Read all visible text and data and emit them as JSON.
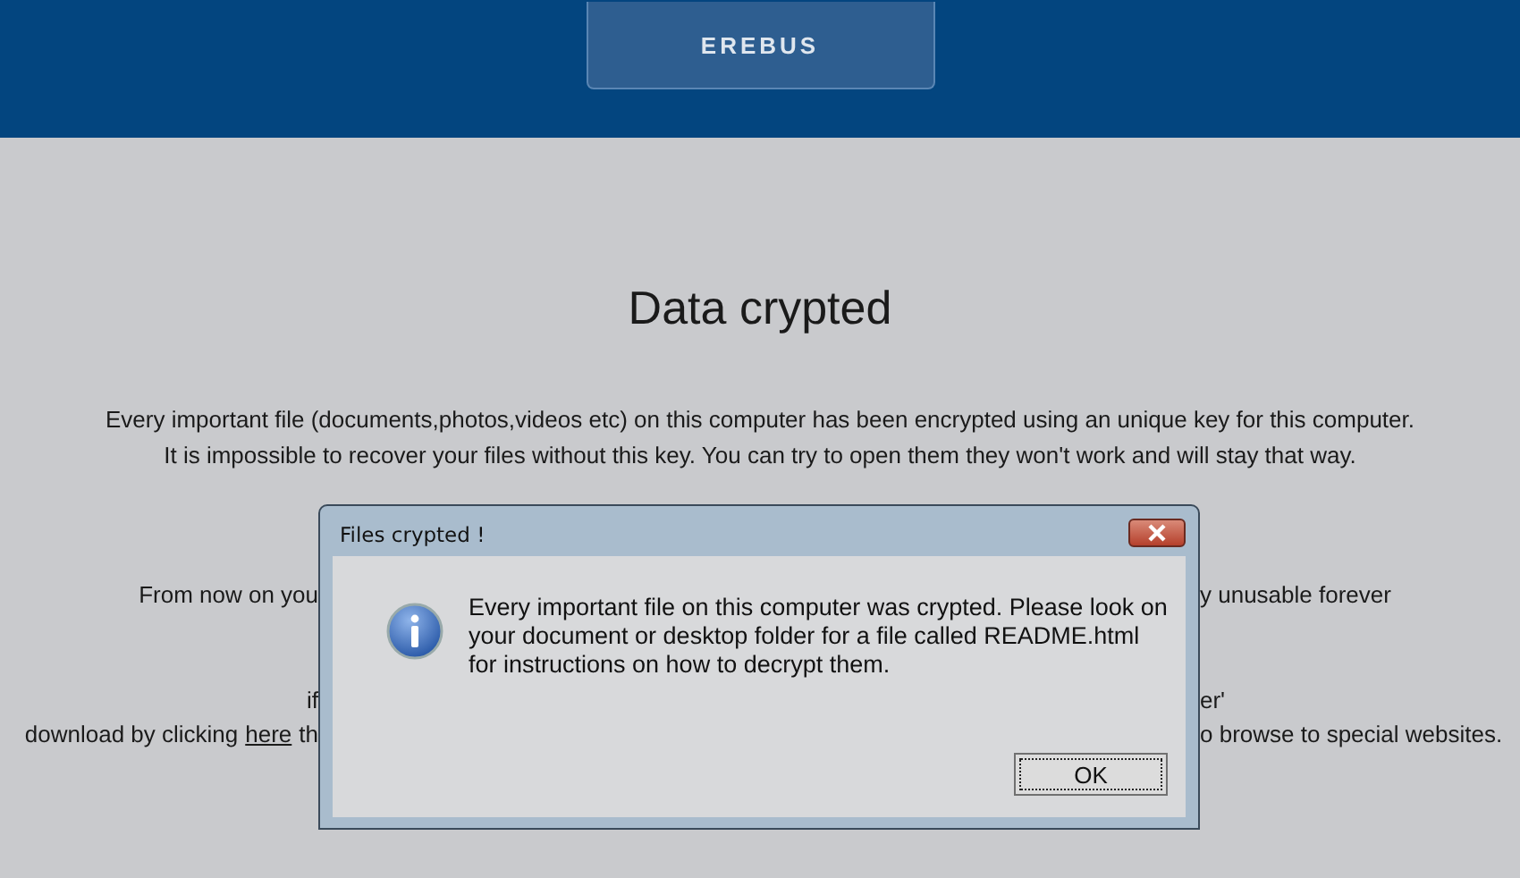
{
  "header": {
    "brand": "EREBUS"
  },
  "page": {
    "title": "Data crypted",
    "intro": [
      "Every important file (documents,photos,videos etc) on this computer has been encrypted using an unique key for this computer.",
      "It is impossible to recover your files without this key. You can try to open them they won't work and will stay that way."
    ],
    "partial_lines": [
      {
        "kind": "plain",
        "left": "From now on you",
        "right": "y unusable forever"
      },
      {
        "kind": "plain",
        "left": "if",
        "right": "er'"
      },
      {
        "kind": "link",
        "left": "download by clicking",
        "link": "here",
        "left_after": "th",
        "right": "o browse to special websites."
      }
    ]
  },
  "dialog": {
    "title": "Files crypted !",
    "message": [
      "Every important file on this computer was crypted. Please look on",
      "your document or desktop folder for a file called README.html",
      "for instructions on how to decrypt them."
    ],
    "ok": "OK"
  }
}
